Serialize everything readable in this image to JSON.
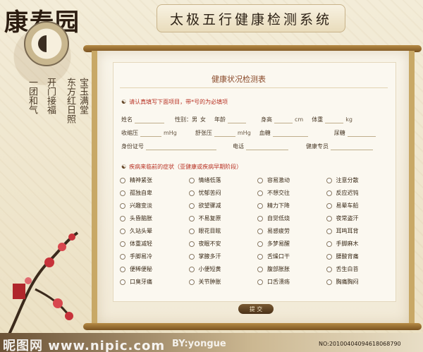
{
  "brand": {
    "logo": "康寿园"
  },
  "header": {
    "title": "太极五行健康检测系统"
  },
  "poem": {
    "col1": "宝玉满堂",
    "col2": "东方红日照",
    "col3": "开门接福",
    "col4": "一团和气"
  },
  "form": {
    "title": "健康状况检测表",
    "hint1": "请认真填写下面项目，带*号的为必填项",
    "basic": {
      "name": "姓名",
      "gender": "性别：",
      "male": "男",
      "female": "女",
      "age": "年龄",
      "height": "身高",
      "height_unit": "cm",
      "weight": "体重",
      "weight_unit": "kg",
      "systolic": "收缩压",
      "systolic_unit": "mHg",
      "diastolic": "舒张压",
      "diastolic_unit": "mHg",
      "blood_sugar": "血糖",
      "urine_sugar": "尿糖",
      "id_no": "身份证号",
      "phone": "电话",
      "consultant": "健康专员"
    },
    "hint2": "疾病来临前的症状（亚健康或疾病早期阶段）",
    "symptoms": [
      "精神紧张",
      "情绪低落",
      "容易激动",
      "注意分散",
      "孤独自卑",
      "忧郁苦闷",
      "不想交往",
      "反应迟钝",
      "兴趣变淡",
      "欲望骤减",
      "精力下降",
      "易晕车船",
      "头昏脑胀",
      "不易复原",
      "自觉低烧",
      "夜常盗汗",
      "久站头晕",
      "眼花目眩",
      "易感疲劳",
      "耳鸣耳背",
      "体重减轻",
      "夜眠不安",
      "多梦易醒",
      "手脚麻木",
      "手脚易冷",
      "掌腋多汗",
      "舌燥口干",
      "腰酸背痛",
      "便稀便秘",
      "小便短黄",
      "腹部胀胀",
      "舌生白苔",
      "口臭牙痛",
      "关节肿胀",
      "口舌溃疡",
      "胸痛胸闷"
    ],
    "submit": "提 交"
  },
  "watermark": {
    "site": "昵图网 www.nipic.com",
    "by": "BY:yongue",
    "no": "NO:20100404094618068790"
  }
}
